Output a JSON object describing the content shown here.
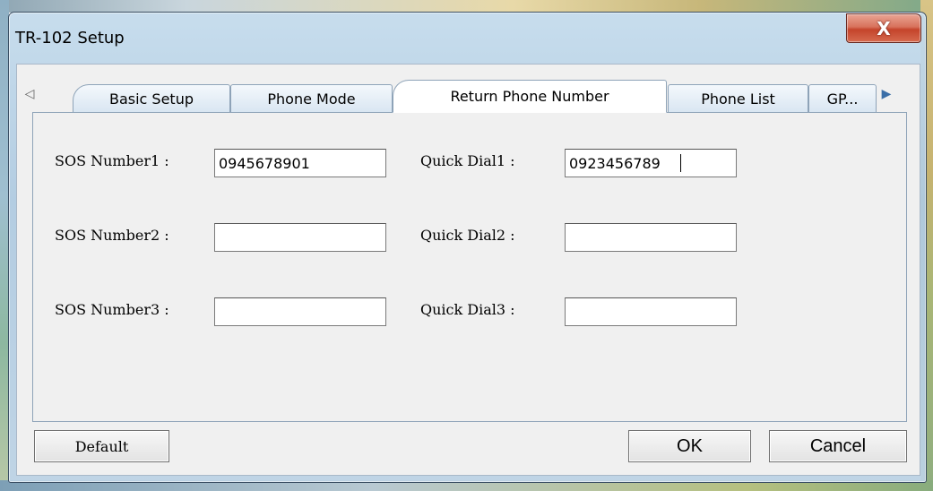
{
  "window": {
    "title": "TR-102 Setup",
    "close_label": "X"
  },
  "tabs": {
    "scroll_left_icon": "◁",
    "scroll_right_icon": "▶",
    "items": [
      {
        "label": "Basic Setup",
        "selected": false
      },
      {
        "label": "Phone Mode",
        "selected": false
      },
      {
        "label": "Return Phone Number",
        "selected": true
      },
      {
        "label": "Phone List",
        "selected": false
      },
      {
        "label": "GP...",
        "selected": false
      }
    ]
  },
  "form": {
    "sos1": {
      "label": "SOS Number1 :",
      "value": "0945678901"
    },
    "sos2": {
      "label": "SOS Number2 :",
      "value": ""
    },
    "sos3": {
      "label": "SOS Number3 :",
      "value": ""
    },
    "quick1": {
      "label": "Quick Dial1 :",
      "value": "0923456789"
    },
    "quick2": {
      "label": "Quick Dial2 :",
      "value": ""
    },
    "quick3": {
      "label": "Quick Dial3 :",
      "value": ""
    }
  },
  "buttons": {
    "default": "Default",
    "ok": "OK",
    "cancel": "Cancel"
  },
  "colors": {
    "title_bar": "#afcae0",
    "close_button": "#c4442b",
    "client_bg": "#f0f0f0",
    "selected_tab_bg": "#ffffff",
    "scroll_right_arrow": "#3b6fa8"
  }
}
